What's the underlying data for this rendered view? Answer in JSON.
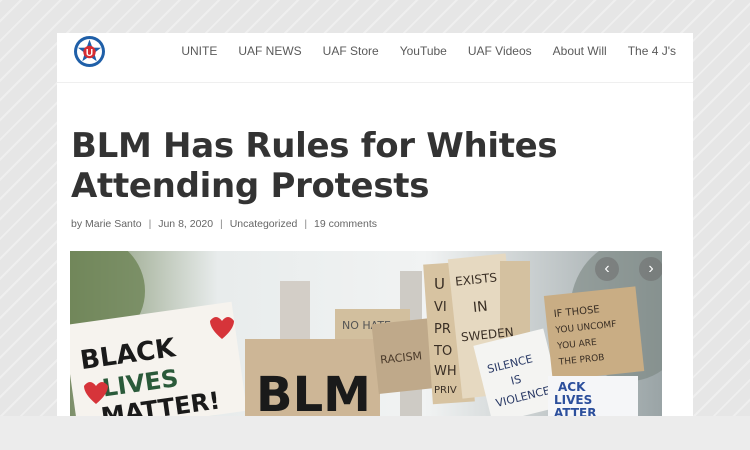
{
  "nav": {
    "items": [
      "UNITE",
      "UAF NEWS",
      "UAF Store",
      "YouTube",
      "UAF Videos",
      "About Will",
      "The 4 J's"
    ]
  },
  "logo": {
    "letter": "U",
    "icon": "star-badge-icon"
  },
  "article": {
    "title": "BLM Has Rules for Whites Attending Protests",
    "meta": {
      "by": "by",
      "author": "Marie Santo",
      "date": "Jun 8, 2020",
      "category": "Uncategorized",
      "comments": "19 comments"
    }
  },
  "hero": {
    "signs": {
      "black_lives_matter": [
        "BLACK",
        "LIVES",
        "MATTER!"
      ],
      "blm": "BLM",
      "no_hate": "NO HATE",
      "racism": "RACISM",
      "exists_in_sweden": [
        "EXISTS",
        "IN",
        "SWEDEN"
      ],
      "silence": [
        "SILENCE",
        "IS",
        "VIOLENCE"
      ],
      "if_those": [
        "IF THOSE",
        "YOU UNCOMF",
        "YOU ARE",
        "THE PROB"
      ],
      "white_privilege": [
        "U",
        "VI",
        "PR",
        "TO",
        "WH",
        "PRIV"
      ],
      "black_lives_bottom": [
        "ACK",
        "LIVES",
        "ATTER"
      ]
    },
    "prev_icon": "chevron-left-icon",
    "next_icon": "chevron-right-icon"
  },
  "colors": {
    "accent_blue": "#1f5fa8",
    "accent_red": "#d62d32",
    "title": "#333333",
    "nav_text": "#5a5a5a"
  }
}
